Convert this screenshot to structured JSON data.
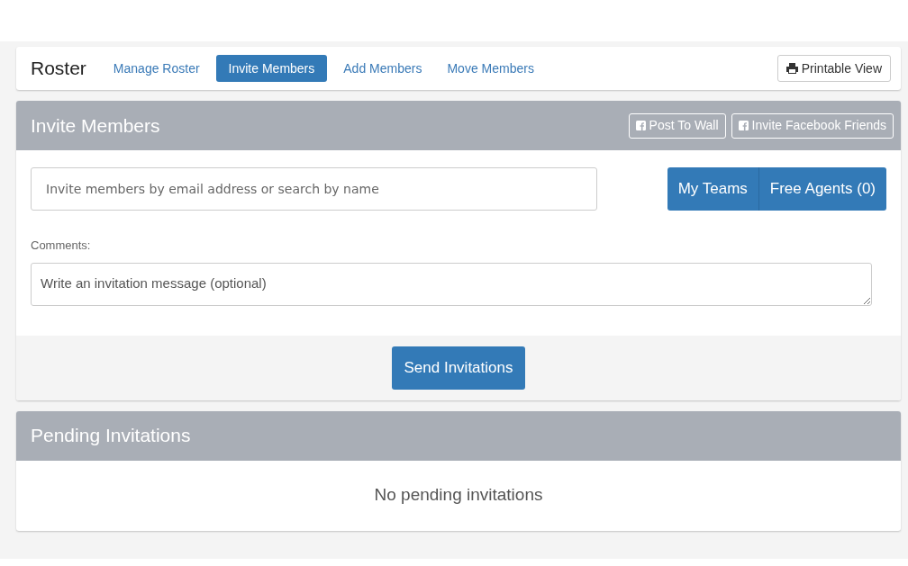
{
  "nav": {
    "title": "Roster",
    "tabs": [
      {
        "label": "Manage Roster",
        "selected": false
      },
      {
        "label": "Invite Members",
        "selected": true
      },
      {
        "label": "Add Members",
        "selected": false
      },
      {
        "label": "Move Members",
        "selected": false
      }
    ],
    "print_button": "Printable View"
  },
  "invite": {
    "title": "Invite Members",
    "header_buttons": [
      "Post To Wall",
      "Invite Facebook Friends"
    ],
    "search": {
      "placeholder": "Invite members by email address or search by name"
    },
    "group_buttons": [
      "My Teams",
      "Free Agents (0)"
    ],
    "comments_label": "Comments:",
    "comments": {
      "placeholder": "Write an invitation message (optional)"
    },
    "submit": "Send Invitations"
  },
  "pending": {
    "title": "Pending Invitations",
    "empty_text": "No pending invitations"
  }
}
